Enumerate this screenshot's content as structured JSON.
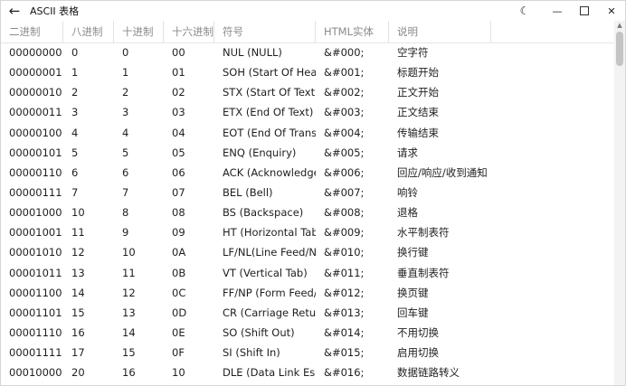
{
  "app": {
    "title": "ASCII 表格"
  },
  "titlebar": {
    "back_icon": "←",
    "theme_icon": "☾",
    "minimize_icon": "—",
    "close_icon": "✕"
  },
  "table": {
    "columns": [
      "二进制",
      "八进制",
      "十进制",
      "十六进制",
      "符号",
      "HTML实体",
      "说明"
    ],
    "rows": [
      [
        "00000000",
        "0",
        "0",
        "00",
        "NUL (NULL)",
        "&#000;",
        "空字符"
      ],
      [
        "00000001",
        "1",
        "1",
        "01",
        "SOH (Start Of Headi",
        "&#001;",
        "标题开始"
      ],
      [
        "00000010",
        "2",
        "2",
        "02",
        "STX (Start Of Text)",
        "&#002;",
        "正文开始"
      ],
      [
        "00000011",
        "3",
        "3",
        "03",
        "ETX (End Of Text)",
        "&#003;",
        "正文结束"
      ],
      [
        "00000100",
        "4",
        "4",
        "04",
        "EOT (End Of Transm",
        "&#004;",
        "传输结束"
      ],
      [
        "00000101",
        "5",
        "5",
        "05",
        "ENQ (Enquiry)",
        "&#005;",
        "请求"
      ],
      [
        "00000110",
        "6",
        "6",
        "06",
        "ACK (Acknowledge)",
        "&#006;",
        "回应/响应/收到通知"
      ],
      [
        "00000111",
        "7",
        "7",
        "07",
        "BEL (Bell)",
        "&#007;",
        "响铃"
      ],
      [
        "00001000",
        "10",
        "8",
        "08",
        "BS (Backspace)",
        "&#008;",
        "退格"
      ],
      [
        "00001001",
        "11",
        "9",
        "09",
        "HT (Horizontal Tab)",
        "&#009;",
        "水平制表符"
      ],
      [
        "00001010",
        "12",
        "10",
        "0A",
        "LF/NL(Line Feed/Nev",
        "&#010;",
        "换行键"
      ],
      [
        "00001011",
        "13",
        "11",
        "0B",
        "VT (Vertical Tab)",
        "&#011;",
        "垂直制表符"
      ],
      [
        "00001100",
        "14",
        "12",
        "0C",
        "FF/NP (Form Feed/N",
        "&#012;",
        "换页键"
      ],
      [
        "00001101",
        "15",
        "13",
        "0D",
        "CR (Carriage Return)",
        "&#013;",
        "回车键"
      ],
      [
        "00001110",
        "16",
        "14",
        "0E",
        "SO (Shift Out)",
        "&#014;",
        "不用切换"
      ],
      [
        "00001111",
        "17",
        "15",
        "0F",
        "SI (Shift In)",
        "&#015;",
        "启用切换"
      ],
      [
        "00010000",
        "20",
        "16",
        "10",
        "DLE (Data Link Escap",
        "&#016;",
        "数据链路转义"
      ]
    ]
  }
}
